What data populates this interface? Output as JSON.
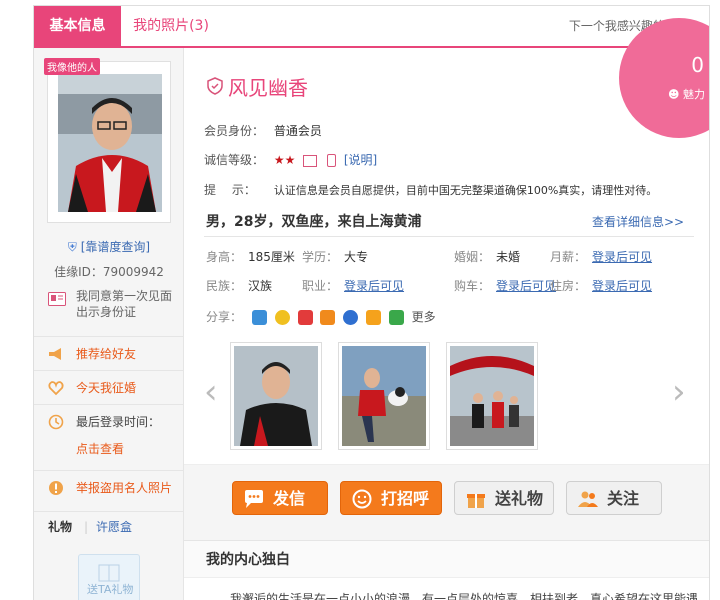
{
  "tabs": {
    "basic": "基本信息",
    "photos": "我的照片(3)",
    "next": "下一个我感兴趣的人>>"
  },
  "left": {
    "lookalike_badge": "我像他的人",
    "credit_query": "[靠谱度查询]",
    "member_id": "佳缘ID：79009942",
    "id_agree": "我同意第一次见面出示身份证",
    "recommend": "推荐给好友",
    "verify_today": "今天我征婚",
    "last_login_label": "最后登录时间：",
    "last_login_link": "点击查看",
    "report": "举报盗用名人照片",
    "gift_tab": "礼物",
    "wish_tab": "许愿盒",
    "gift_send": "送TA礼物"
  },
  "charm": {
    "value": "0",
    "label": "魅力"
  },
  "profile": {
    "nickname": "风见幽香",
    "member_label": "会员身份：",
    "member_value": "普通会员",
    "credit_label": "诚信等级：",
    "credit_stars": "★★",
    "credit_explain": "[说明]",
    "tip_label": "提　 示：",
    "tip_value": "认证信息是会员自愿提供，目前中国无完整渠道确保100%真实，请理性对待。",
    "summary": "男，28岁，双鱼座，来自上海黄浦",
    "details_link": "查看详细信息>>"
  },
  "facts": {
    "height_k": "身高：",
    "height_v": "185厘米",
    "edu_k": "学历：",
    "edu_v": "大专",
    "marriage_k": "婚姻：",
    "marriage_v": "未婚",
    "salary_k": "月薪：",
    "salary_v": "登录后可见",
    "nation_k": "民族：",
    "nation_v": "汉族",
    "job_k": "职业：",
    "job_v": "登录后可见",
    "car_k": "购车：",
    "car_v": "登录后可见",
    "house_k": "住房：",
    "house_v": "登录后可见"
  },
  "share": {
    "label": "分享：",
    "more": "更多"
  },
  "buttons": {
    "message": "发信",
    "greet": "打招呼",
    "gift": "送礼物",
    "follow": "关注"
  },
  "monologue": {
    "title": "我的内心独白",
    "text": "我邂逅的生活是在一点小小的浪漫，有一点层处的惊喜，相扶到老，真心希望在这里能遇"
  },
  "colors": {
    "accent": "#e8457a",
    "orange": "#f47a1c",
    "link": "#3b6ab2"
  }
}
